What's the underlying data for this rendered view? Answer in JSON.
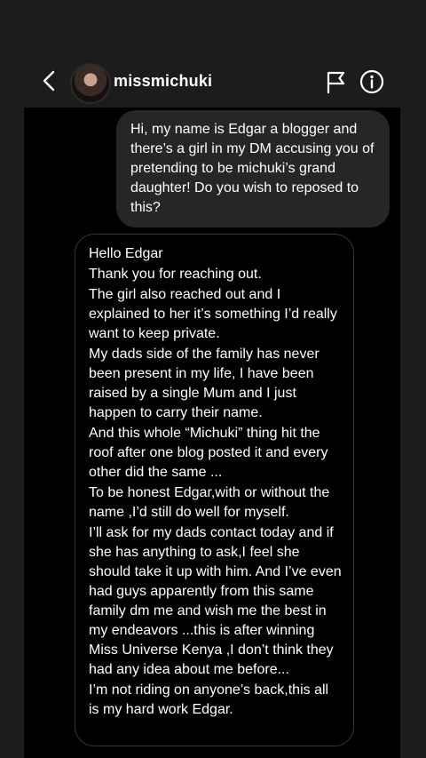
{
  "header": {
    "username": "missmichuki",
    "icons": [
      "back-arrow-icon",
      "flag-icon",
      "info-icon"
    ]
  },
  "messages": {
    "outgoing": "Hi, my name is Edgar a blogger and there’s a girl in my DM accusing you of pretending to be michuki’s grand daughter! Do you wish to reposed to this?",
    "incoming": [
      "Hello Edgar",
      "Thank you for reaching out.",
      "The girl also reached out and I explained to her it’s something I’d really want to keep private.",
      "My dads side of the family has never been present in my life, I have been raised by a single Mum and I just happen to carry their name.",
      "And this whole “Michuki” thing hit the roof after one blog posted it and every other did the same ...",
      "To be honest Edgar,with or without the name ,I’d still do well for myself.",
      "I’ll ask for my dads contact today and if she has anything to ask,I feel she should take it up with him. And I’ve even had guys apparently from this same family dm me and wish me the best in my endeavors ...this is after winning Miss Universe Kenya ,I don’t think they had any idea about me before...",
      "I’m not riding on anyone’s back,this all is my hard work Edgar."
    ]
  },
  "colors": {
    "background": "#1c1c1c",
    "thread_background": "#000000",
    "outgoing_bubble": "#262626",
    "incoming_border": "#363636",
    "text": "#ffffff"
  }
}
